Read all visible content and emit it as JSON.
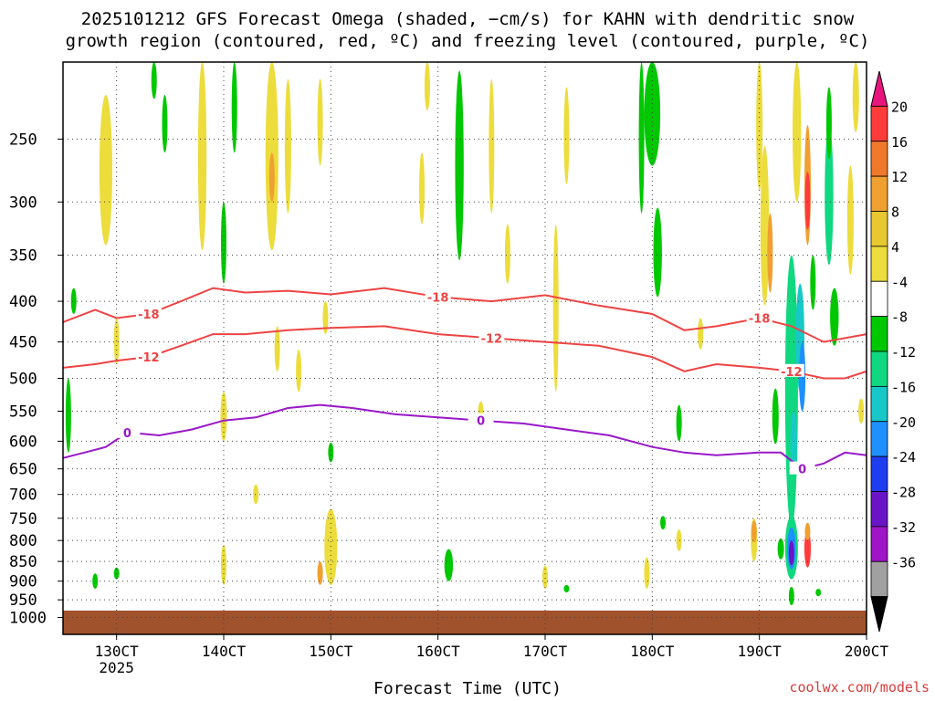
{
  "chart_data": {
    "type": "heatmap",
    "title_lines": [
      "2025101212 GFS Forecast Omega (shaded, −cm/s) for KAHN with dendritic snow",
      "growth region (contoured, red, ºC) and freezing level (contoured, purple, ºC)"
    ],
    "xlabel": "Forecast Time (UTC)",
    "x_ticks": [
      "130CT",
      "140CT",
      "150CT",
      "160CT",
      "170CT",
      "180CT",
      "190CT",
      "200CT"
    ],
    "x_tick_sub": "2025",
    "xlim": [
      12.5,
      20.0
    ],
    "y_ticks": [
      250,
      300,
      350,
      400,
      450,
      500,
      550,
      600,
      650,
      700,
      750,
      800,
      850,
      900,
      950,
      1000
    ],
    "ylim": [
      1050,
      200
    ],
    "y_scale": "log-pressure",
    "ground_level": 980,
    "colorbar": {
      "labels": [
        "20",
        "16",
        "12",
        "8",
        "4",
        "-4",
        "-8",
        "-12",
        "-16",
        "-20",
        "-24",
        "-28",
        "-32",
        "-36"
      ],
      "colors": [
        "#e8157f",
        "#ff3b3b",
        "#f0782a",
        "#f0a030",
        "#e8c830",
        "#ecdc3c",
        "#ffffff",
        "#00c800",
        "#10d880",
        "#18c8c8",
        "#1e90ff",
        "#1e3cf0",
        "#6a14c8",
        "#a014c8",
        "#a0a0a0",
        "#000000"
      ]
    },
    "contours": [
      {
        "label": "-18",
        "color": "#ee4444",
        "x": [
          12.5,
          12.8,
          13.0,
          13.3,
          13.6,
          13.9,
          14.2,
          14.6,
          15.0,
          15.5,
          16.0,
          16.5,
          17.0,
          17.5,
          18.0,
          18.3,
          18.6,
          19.0,
          19.3,
          19.6,
          20.0
        ],
        "p": [
          425,
          410,
          420,
          415,
          400,
          385,
          390,
          388,
          392,
          385,
          395,
          400,
          393,
          405,
          415,
          435,
          430,
          420,
          430,
          450,
          440
        ]
      },
      {
        "label": "-12",
        "color": "#ee4444",
        "x": [
          12.5,
          12.8,
          13.0,
          13.3,
          13.6,
          13.9,
          14.2,
          14.6,
          15.0,
          15.5,
          16.0,
          16.5,
          17.0,
          17.5,
          18.0,
          18.3,
          18.6,
          19.0,
          19.3,
          19.6,
          19.8,
          20.0
        ],
        "p": [
          485,
          480,
          475,
          470,
          455,
          440,
          440,
          435,
          432,
          430,
          440,
          445,
          450,
          455,
          470,
          490,
          480,
          485,
          490,
          500,
          500,
          490
        ]
      },
      {
        "label": "0",
        "color": "#9918c8",
        "x": [
          12.5,
          12.7,
          12.9,
          13.1,
          13.4,
          13.7,
          14.0,
          14.3,
          14.6,
          14.9,
          15.2,
          15.6,
          16.0,
          16.4,
          16.8,
          17.2,
          17.6,
          18.0,
          18.3,
          18.6,
          19.0,
          19.2,
          19.4,
          19.6,
          19.8,
          20.0
        ],
        "p": [
          630,
          620,
          610,
          585,
          590,
          580,
          565,
          560,
          545,
          540,
          545,
          555,
          560,
          565,
          570,
          580,
          590,
          610,
          620,
          625,
          620,
          620,
          650,
          640,
          620,
          625
        ]
      }
    ],
    "omega_patches": [
      {
        "x": 12.8,
        "p": 900,
        "w": 0.05,
        "h": 40,
        "v": -4.5
      },
      {
        "x": 13.0,
        "p": 880,
        "w": 0.04,
        "h": 30,
        "v": -5.0
      },
      {
        "x": 12.55,
        "p": 560,
        "w": 0.04,
        "h": 120,
        "v": -6.0
      },
      {
        "x": 12.6,
        "p": 400,
        "w": 0.03,
        "h": 30,
        "v": -5.0
      },
      {
        "x": 12.9,
        "p": 280,
        "w": 0.12,
        "h": 120,
        "v": 5.0
      },
      {
        "x": 13.0,
        "p": 450,
        "w": 0.05,
        "h": 60,
        "v": 5.0
      },
      {
        "x": 13.45,
        "p": 240,
        "w": 0.05,
        "h": 40,
        "v": -5.0
      },
      {
        "x": 13.35,
        "p": 210,
        "w": 0.04,
        "h": 25,
        "v": -5.0
      },
      {
        "x": 13.8,
        "p": 270,
        "w": 0.08,
        "h": 150,
        "v": 5.0
      },
      {
        "x": 14.0,
        "p": 340,
        "w": 0.05,
        "h": 80,
        "v": -6.0
      },
      {
        "x": 14.1,
        "p": 230,
        "w": 0.05,
        "h": 60,
        "v": -6.0
      },
      {
        "x": 14.45,
        "p": 270,
        "w": 0.12,
        "h": 150,
        "v": 5.0
      },
      {
        "x": 14.45,
        "p": 280,
        "w": 0.05,
        "h": 40,
        "v": 9.0
      },
      {
        "x": 14.6,
        "p": 260,
        "w": 0.06,
        "h": 100,
        "v": 5.0
      },
      {
        "x": 14.9,
        "p": 240,
        "w": 0.03,
        "h": 60,
        "v": 5.0
      },
      {
        "x": 14.0,
        "p": 560,
        "w": 0.06,
        "h": 80,
        "v": 5.0
      },
      {
        "x": 14.0,
        "p": 860,
        "w": 0.05,
        "h": 100,
        "v": 5.0
      },
      {
        "x": 14.5,
        "p": 460,
        "w": 0.04,
        "h": 60,
        "v": 5.0
      },
      {
        "x": 14.7,
        "p": 490,
        "w": 0.03,
        "h": 60,
        "v": 5.0
      },
      {
        "x": 14.3,
        "p": 700,
        "w": 0.03,
        "h": 40,
        "v": 5.0
      },
      {
        "x": 15.0,
        "p": 820,
        "w": 0.12,
        "h": 180,
        "v": 5.0
      },
      {
        "x": 14.9,
        "p": 880,
        "w": 0.05,
        "h": 60,
        "v": 9.0
      },
      {
        "x": 15.0,
        "p": 620,
        "w": 0.04,
        "h": 35,
        "v": -6.0
      },
      {
        "x": 14.95,
        "p": 420,
        "w": 0.03,
        "h": 40,
        "v": 5.0
      },
      {
        "x": 15.9,
        "p": 210,
        "w": 0.04,
        "h": 40,
        "v": 5.0
      },
      {
        "x": 15.85,
        "p": 290,
        "w": 0.04,
        "h": 60,
        "v": 5.0
      },
      {
        "x": 16.2,
        "p": 280,
        "w": 0.08,
        "h": 150,
        "v": -6.0
      },
      {
        "x": 16.5,
        "p": 260,
        "w": 0.04,
        "h": 100,
        "v": 5.0
      },
      {
        "x": 16.65,
        "p": 350,
        "w": 0.03,
        "h": 60,
        "v": 5.0
      },
      {
        "x": 16.1,
        "p": 860,
        "w": 0.08,
        "h": 80,
        "v": -6.0
      },
      {
        "x": 16.4,
        "p": 550,
        "w": 0.03,
        "h": 30,
        "v": 5.0
      },
      {
        "x": 17.1,
        "p": 420,
        "w": 0.05,
        "h": 200,
        "v": 5.0
      },
      {
        "x": 17.2,
        "p": 250,
        "w": 0.03,
        "h": 70,
        "v": 5.0
      },
      {
        "x": 17.0,
        "p": 890,
        "w": 0.04,
        "h": 60,
        "v": 5.0
      },
      {
        "x": 17.2,
        "p": 920,
        "w": 0.02,
        "h": 20,
        "v": -6.0
      },
      {
        "x": 18.0,
        "p": 230,
        "w": 0.15,
        "h": 80,
        "v": -6.0
      },
      {
        "x": 18.05,
        "p": 350,
        "w": 0.08,
        "h": 90,
        "v": -6.0
      },
      {
        "x": 17.9,
        "p": 250,
        "w": 0.04,
        "h": 120,
        "v": -6.0
      },
      {
        "x": 18.25,
        "p": 570,
        "w": 0.05,
        "h": 60,
        "v": -6.0
      },
      {
        "x": 18.1,
        "p": 760,
        "w": 0.04,
        "h": 30,
        "v": -6.0
      },
      {
        "x": 18.25,
        "p": 800,
        "w": 0.05,
        "h": 50,
        "v": 5.0
      },
      {
        "x": 17.95,
        "p": 880,
        "w": 0.05,
        "h": 80,
        "v": 5.0
      },
      {
        "x": 18.45,
        "p": 440,
        "w": 0.04,
        "h": 40,
        "v": 5.0
      },
      {
        "x": 18.95,
        "p": 800,
        "w": 0.06,
        "h": 100,
        "v": 5.0
      },
      {
        "x": 18.95,
        "p": 780,
        "w": 0.03,
        "h": 50,
        "v": 9.0
      },
      {
        "x": 19.15,
        "p": 560,
        "w": 0.06,
        "h": 90,
        "v": -6.0
      },
      {
        "x": 19.2,
        "p": 820,
        "w": 0.06,
        "h": 50,
        "v": -6.0
      },
      {
        "x": 19.0,
        "p": 240,
        "w": 0.06,
        "h": 100,
        "v": 5.0
      },
      {
        "x": 19.05,
        "p": 330,
        "w": 0.08,
        "h": 150,
        "v": 5.0
      },
      {
        "x": 19.1,
        "p": 350,
        "w": 0.03,
        "h": 80,
        "v": 9.0
      },
      {
        "x": 19.35,
        "p": 250,
        "w": 0.08,
        "h": 100,
        "v": 5.0
      },
      {
        "x": 19.45,
        "p": 290,
        "w": 0.06,
        "h": 100,
        "v": 9.0
      },
      {
        "x": 19.45,
        "p": 300,
        "w": 0.04,
        "h": 50,
        "v": 17.0
      },
      {
        "x": 19.5,
        "p": 380,
        "w": 0.05,
        "h": 60,
        "v": -6.0
      },
      {
        "x": 19.65,
        "p": 300,
        "w": 0.08,
        "h": 120,
        "v": -10.0
      },
      {
        "x": 19.65,
        "p": 240,
        "w": 0.05,
        "h": 50,
        "v": -6.0
      },
      {
        "x": 19.85,
        "p": 320,
        "w": 0.06,
        "h": 100,
        "v": 5.0
      },
      {
        "x": 19.9,
        "p": 220,
        "w": 0.06,
        "h": 50,
        "v": 5.0
      },
      {
        "x": 19.7,
        "p": 420,
        "w": 0.08,
        "h": 70,
        "v": -6.0
      },
      {
        "x": 19.95,
        "p": 550,
        "w": 0.03,
        "h": 40,
        "v": 5.0
      },
      {
        "x": 19.3,
        "p": 560,
        "w": 0.12,
        "h": 420,
        "v": -10.0
      },
      {
        "x": 19.38,
        "p": 450,
        "w": 0.08,
        "h": 140,
        "v": -14.0
      },
      {
        "x": 19.4,
        "p": 500,
        "w": 0.06,
        "h": 100,
        "v": -18.0
      },
      {
        "x": 19.32,
        "p": 600,
        "w": 0.06,
        "h": 100,
        "v": -14.0
      },
      {
        "x": 19.3,
        "p": 820,
        "w": 0.12,
        "h": 150,
        "v": -10.0
      },
      {
        "x": 19.3,
        "p": 820,
        "w": 0.08,
        "h": 100,
        "v": -18.0
      },
      {
        "x": 19.3,
        "p": 830,
        "w": 0.04,
        "h": 60,
        "v": -26.0
      },
      {
        "x": 19.45,
        "p": 820,
        "w": 0.06,
        "h": 90,
        "v": 17.0
      },
      {
        "x": 19.45,
        "p": 780,
        "w": 0.04,
        "h": 40,
        "v": 9.0
      },
      {
        "x": 19.3,
        "p": 940,
        "w": 0.05,
        "h": 50,
        "v": -6.0
      },
      {
        "x": 19.55,
        "p": 930,
        "w": 0.03,
        "h": 20,
        "v": -6.0
      }
    ]
  },
  "attribution": "coolwx.com/models"
}
